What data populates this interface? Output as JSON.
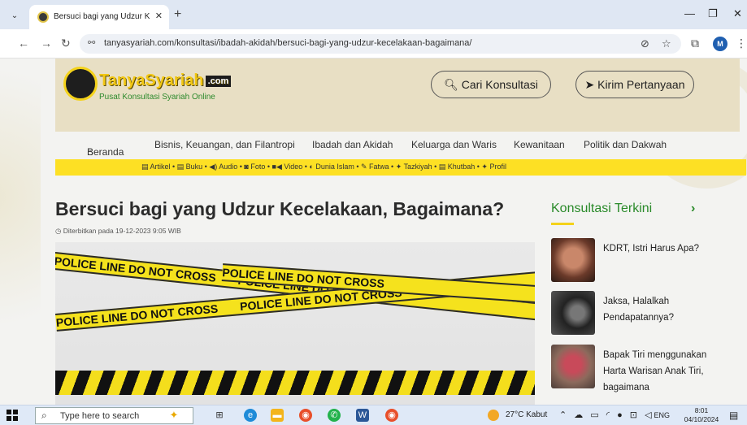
{
  "browser": {
    "tab_title": "Bersuci bagi yang Udzur Kecela",
    "url": "tanyasyariah.com/konsultasi/ibadah-akidah/bersuci-bagi-yang-udzur-kecelakaan-bagaimana/",
    "profile_initial": "M"
  },
  "site": {
    "logo_name": "TanyaSyariah",
    "logo_domain": ".com",
    "tagline": "Pusat Konsultasi Syariah Online",
    "search_button": "Cari Konsultasi",
    "ask_button": "Kirim Pertanyaan",
    "nav": {
      "home": "Beranda",
      "item1": "Bisnis, Keuangan, dan Filantropi",
      "item2": "Ibadah dan Akidah",
      "item3": "Keluarga dan Waris",
      "item4": "Kewanitaan",
      "item5": "Politik dan Dakwah"
    },
    "subnav": "▤ Artikel • ▤ Buku • ◀) Audio • ◙ Foto • ■◀ Video • ◐ Dunia Islam • ✎ Fatwa • ✦ Tazkiyah • ▤ Khutbah • ✦ Profil"
  },
  "article": {
    "title": "Bersuci bagi yang Udzur Kecelakaan, Bagaimana?",
    "published": "Diterbitkan pada 19-12-2023 9:05 WIB",
    "tape_text": "POLICE LINE DO NOT CROSS"
  },
  "sidebar": {
    "title": "Konsultasi Terkini",
    "posts": [
      {
        "title": "KDRT, Istri Harus Apa?"
      },
      {
        "title": "Jaksa, Halalkah Pendapatannya?"
      },
      {
        "title": "Bapak Tiri menggunakan Harta Warisan Anak Tiri, bagaimana"
      }
    ]
  },
  "taskbar": {
    "search_placeholder": "Type here to search",
    "weather": "27°C  Kabut",
    "language": "ENG",
    "time": "8:01",
    "date": "04/10/2024"
  },
  "colors": {
    "brand_yellow": "#f2c713",
    "brand_green": "#2a8a2a",
    "subnav_bg": "#fde024",
    "header_bg": "#e8dfc4"
  }
}
